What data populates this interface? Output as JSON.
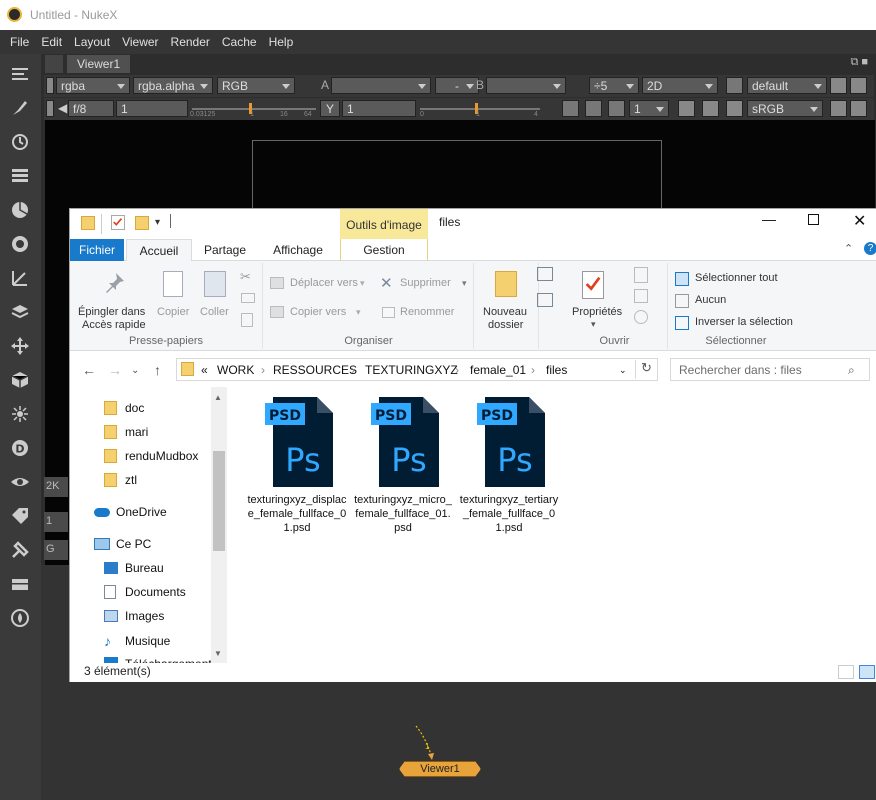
{
  "nuke": {
    "title": "Untitled - NukeX",
    "menu": [
      "File",
      "Edit",
      "Layout",
      "Viewer",
      "Render",
      "Cache",
      "Help"
    ],
    "viewer_tab": "Viewer1",
    "row1": {
      "channels": "rgba",
      "alpha": "rgba.alpha",
      "display": "RGB",
      "a_label": "A",
      "a_value": "",
      "dash": "-",
      "b_label": "B",
      "b_value": "",
      "downrez": "÷5",
      "view_mode": "2D",
      "lut": "default"
    },
    "row2": {
      "fstop": "f/8",
      "gain": "1",
      "slider_ticks": [
        "0.03125",
        "1",
        "16",
        "64"
      ],
      "y_label": "Y",
      "gamma": "1",
      "gamma_ticks": [
        "0",
        "1",
        "4"
      ],
      "proxy_value": "1",
      "colorspace": "sRGB"
    },
    "side_bits": [
      "2K",
      "1",
      "G"
    ],
    "node_label": "Viewer1",
    "node_input": "1"
  },
  "explorer": {
    "quick_access_icons": [
      "folder-icon",
      "checklist-icon",
      "folder-icon",
      "dropdown-icon"
    ],
    "tools_tab": "Outils d'image",
    "window_title": "files",
    "tabs": [
      "Fichier",
      "Accueil",
      "Partage",
      "Affichage",
      "Gestion"
    ],
    "ribbon": {
      "pin": [
        "Épingler dans",
        "Accès rapide"
      ],
      "copy": "Copier",
      "paste": "Coller",
      "group_clipboard": "Presse-papiers",
      "move_to": "Déplacer vers",
      "copy_to": "Copier vers",
      "delete": "Supprimer",
      "rename": "Renommer",
      "group_organize": "Organiser",
      "new_folder": [
        "Nouveau",
        "dossier"
      ],
      "properties": "Propriétés",
      "group_open": "Ouvrir",
      "select_all": "Sélectionner tout",
      "select_none": "Aucun",
      "invert_selection": "Inverser la sélection",
      "group_select": "Sélectionner"
    },
    "path": [
      "«",
      "WORK",
      "›",
      "RESSOURCES",
      "›",
      "TEXTURINGXYZ",
      "›",
      "female_01",
      "›",
      "files"
    ],
    "search_placeholder": "Rechercher dans : files",
    "nav": {
      "folders": [
        "doc",
        "mari",
        "renduMudbox",
        "ztl"
      ],
      "onedrive": "OneDrive",
      "thispc": "Ce PC",
      "pc_items": [
        "Bureau",
        "Documents",
        "Images",
        "Musique",
        "Téléchargement"
      ]
    },
    "files": [
      {
        "badge": "PSD",
        "glyph": "Ps",
        "name": "texturingxyz_displace_female_fullface_01.psd"
      },
      {
        "badge": "PSD",
        "glyph": "Ps",
        "name": "texturingxyz_micro_female_fullface_01.psd"
      },
      {
        "badge": "PSD",
        "glyph": "Ps",
        "name": "texturingxyz_tertiary_female_fullface_01.psd"
      }
    ],
    "status": "3 élément(s)"
  }
}
